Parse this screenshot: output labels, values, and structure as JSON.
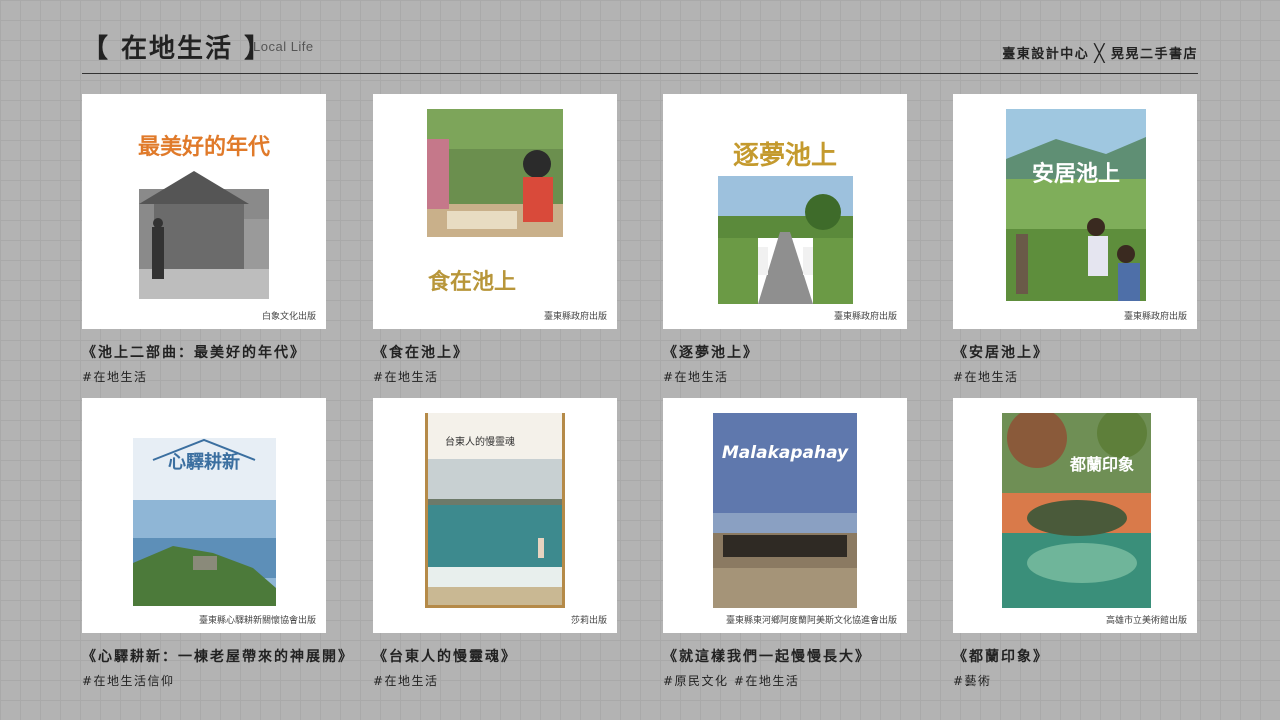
{
  "header": {
    "title": "【 在地生活 】",
    "subtitle": "Local Life",
    "brand_left": "臺東設計中心",
    "brand_sep": "╳",
    "brand_right": "晃晃二手書店"
  },
  "books": [
    {
      "title": "《池上二部曲：最美好的年代》",
      "tags": "#在地生活",
      "publisher": "白象文化出版",
      "cover_text": "最美好的年代",
      "cover_icon": "old-house-photo-icon"
    },
    {
      "title": "《食在池上》",
      "tags": "#在地生活",
      "publisher": "臺東縣政府出版",
      "cover_text": "食在池上",
      "cover_icon": "picnic-photo-icon"
    },
    {
      "title": "《逐夢池上》",
      "tags": "#在地生活",
      "publisher": "臺東縣政府出版",
      "cover_text": "逐夢池上",
      "cover_icon": "cyclists-photo-icon"
    },
    {
      "title": "《安居池上》",
      "tags": "#在地生活",
      "publisher": "臺東縣政府出版",
      "cover_text": "安居池上",
      "cover_icon": "family-fields-photo-icon"
    },
    {
      "title": "《心驛耕新：一棟老屋帶來的神展開》",
      "tags": "#在地生活信仰",
      "publisher": "臺東縣心驛耕新關懷協會出版",
      "cover_text": "心驛耕新",
      "cover_icon": "coast-photo-icon"
    },
    {
      "title": "《台東人的慢靈魂》",
      "tags": "#在地生活",
      "publisher": "莎莉出版",
      "cover_text": "台東人的慢靈魂",
      "cover_icon": "beach-photo-icon"
    },
    {
      "title": "《就這樣我們一起慢慢長大》",
      "tags": "#原民文化 #在地生活",
      "publisher": "臺東縣東河鄉阿度蘭阿美斯文化協進會出版",
      "cover_text": "Malakapahay",
      "cover_icon": "dancers-photo-icon"
    },
    {
      "title": "《都蘭印象》",
      "tags": "#藝術",
      "publisher": "高雄市立美術館出版",
      "cover_text": "都蘭印象",
      "cover_icon": "painting-icon"
    }
  ]
}
